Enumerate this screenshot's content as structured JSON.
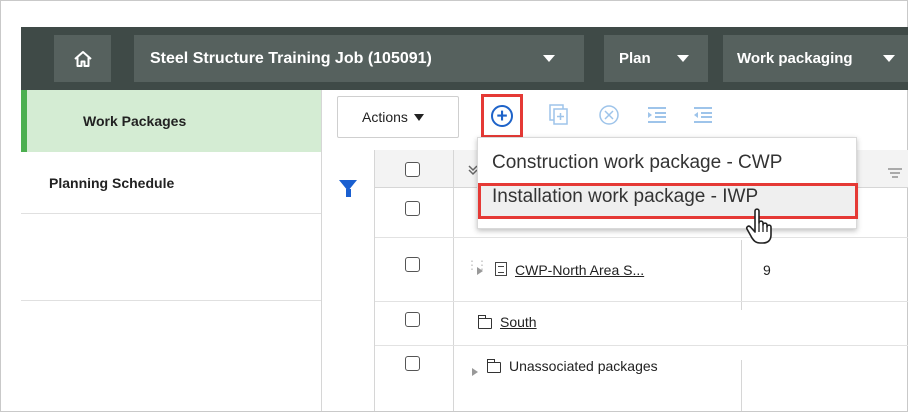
{
  "topbar": {
    "home_icon": "home-icon",
    "job_label": "Steel Structure Training Job (105091)",
    "plan_label": "Plan",
    "work_label": "Work packaging",
    "bg_color": "#3f4a47",
    "segment_color": "#56615e"
  },
  "sidebar": {
    "items": [
      {
        "label": "Work Packages",
        "active": true
      },
      {
        "label": "Planning Schedule",
        "active": false
      }
    ],
    "active_color": "#d4ecd3",
    "accent_color": "#4caf50"
  },
  "toolbar": {
    "actions_label": "Actions",
    "tools": [
      {
        "icon": "add-circle-icon",
        "highlighted": true
      },
      {
        "icon": "copy-add-icon"
      },
      {
        "icon": "remove-circle-icon"
      },
      {
        "icon": "indent-icon"
      },
      {
        "icon": "outdent-icon"
      }
    ]
  },
  "menu": {
    "items": [
      {
        "label": "Construction work package - CWP"
      },
      {
        "label": "Installation work package - IWP",
        "highlighted": true
      }
    ],
    "highlight_color": "#e53935"
  },
  "grid": {
    "rows": [
      {
        "name": "CWP-North Area S...",
        "count": "9",
        "type": "package"
      },
      {
        "name": "South",
        "type": "folder"
      },
      {
        "name": "Unassociated packages",
        "type": "folder"
      }
    ]
  }
}
